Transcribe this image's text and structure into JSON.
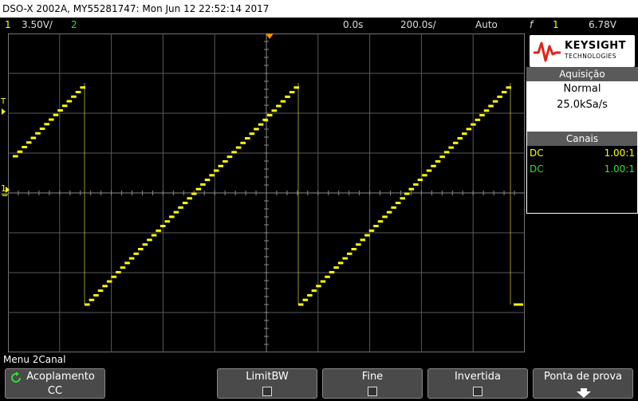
{
  "titlebar": {
    "text": "DSO-X 2002A, MY55281747: Mon Jun 12 22:52:14 2017"
  },
  "status": {
    "ch1_num": "1",
    "ch1_scale": "3.50V/",
    "ch2_num": "2",
    "delay": "0.0s",
    "timebase": "200.0s/",
    "trigger_mode": "Auto",
    "trig_symbol": "f",
    "trig_ch": "1",
    "trig_level": "6.78V",
    "colors": {
      "ch1": "#ffff00",
      "ch2": "#33dd33",
      "text": "#dddddd"
    }
  },
  "brand": {
    "name": "KEYSIGHT",
    "sub": "TECHNOLOGIES"
  },
  "acquisition": {
    "header": "Aquisição",
    "mode": "Normal",
    "rate": "25.0kSa/s"
  },
  "channels": {
    "header": "Canais",
    "rows": [
      {
        "coupling": "DC",
        "probe": "1.00:1",
        "color": "#ffff00"
      },
      {
        "coupling": "DC",
        "probe": "1.00:1",
        "color": "#33dd33"
      }
    ]
  },
  "display": {
    "trigger_marker": "T",
    "ground_marker": "1"
  },
  "menu": {
    "label": "Menu 2Canal"
  },
  "softkeys": {
    "coupling": {
      "label": "Acoplamento",
      "value": "CC"
    },
    "bwlimit": {
      "label": "LimitBW"
    },
    "fine": {
      "label": "Fine"
    },
    "invert": {
      "label": "Invertida"
    },
    "probe": {
      "label": "Ponta de prova"
    }
  }
}
